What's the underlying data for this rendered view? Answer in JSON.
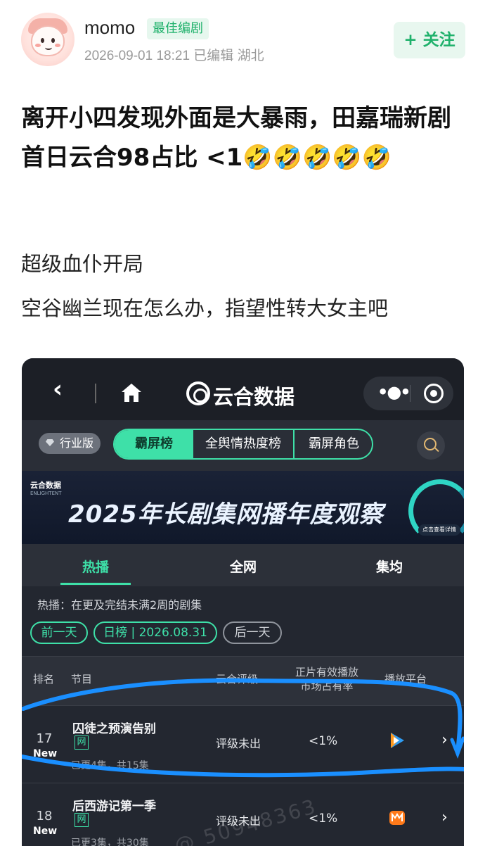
{
  "post": {
    "username": "momo",
    "badge": "最佳编剧",
    "meta": "2026-09-01 18:21  已编辑  湖北",
    "follow_label": "+ 关注",
    "title": "离开小四发现外面是大暴雨，田嘉瑞新剧首日云合98占比 <1🤣🤣🤣🤣🤣",
    "body_lines": [
      "超级血仆开局",
      "空谷幽兰现在怎么办，指望性转大女主吧"
    ]
  },
  "screenshot": {
    "nav": {
      "back_icon": "chevron-left-icon",
      "home_icon": "home-icon",
      "title": "云合数据",
      "menu_icon": "more-dots-icon",
      "close_icon": "target-icon"
    },
    "filter_bar": {
      "industry_label": "行业版",
      "segments": [
        "霸屏榜",
        "全舆情热度榜",
        "霸屏角色"
      ],
      "active_segment": "霸屏榜",
      "search_icon": "search-icon"
    },
    "banner": {
      "logo_text": "云合数据",
      "logo_sub": "ENLIGHTENT",
      "title": "2025年长剧集网播年度观察",
      "cta": "点击查看详情"
    },
    "content_tabs": [
      "热播",
      "全网",
      "集均"
    ],
    "active_tab": "热播",
    "description": "热播：在更及完结未满2周的剧集",
    "date_controls": {
      "prev": "前一天",
      "current": "日榜 | 2026.08.31",
      "next": "后一天"
    },
    "table_headers": [
      "排名",
      "节目",
      "云合评级",
      "正片有效播放\n市场占有率",
      "播放平台"
    ],
    "rows": [
      {
        "rank": "17",
        "new_label": "New",
        "name": "囚徒之预演告别",
        "tag": "网",
        "sub": "已更4集，共15集",
        "rating": "评级未出",
        "share": "<1%",
        "platform_icon": "tencent-video-icon"
      },
      {
        "rank": "18",
        "new_label": "New",
        "name": "后西游记第一季",
        "tag": "网",
        "sub": "已更3集，共30集",
        "rating": "评级未出",
        "share": "<1%",
        "platform_icon": "mango-tv-icon"
      }
    ],
    "watermark": "@ 50948363"
  },
  "colors": {
    "accent_green": "#3ee0a8",
    "follow_green": "#1fb16b",
    "scribble_blue": "#1a8fff",
    "dark_bg": "#232730"
  }
}
